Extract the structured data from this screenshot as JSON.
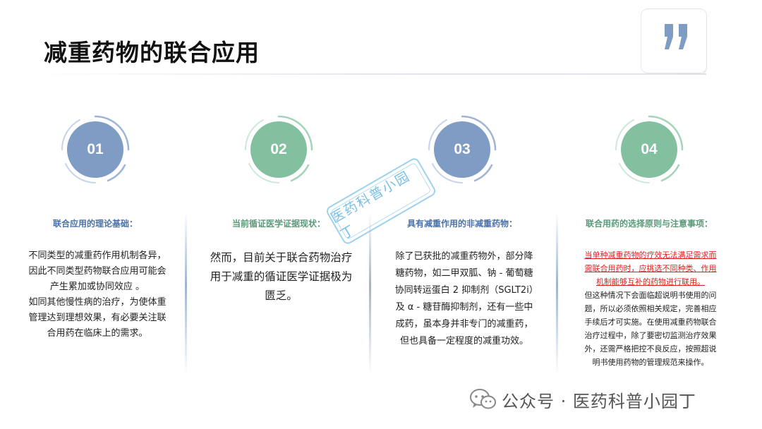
{
  "header": {
    "title": "减重药物的联合应用"
  },
  "colors": {
    "blue_badge": "#7f9cc4",
    "green_badge": "#82c09f",
    "blue_heading": "#4a72a8",
    "green_heading": "#5a9a7a",
    "highlight_red": "#e02020"
  },
  "columns": [
    {
      "number": "01",
      "heading": "联合应用的理论基础：",
      "paragraphs": [
        "不同类型的减重药作用机制各异，因此不同类型药物联合应用可能会产生累加或协同效应 。",
        "如同其他慢性病的治疗，为使体重管理达到理想效果，有必要关注联合用药在临床上的需求。"
      ]
    },
    {
      "number": "02",
      "heading": "当前循证医学证据现状：",
      "paragraphs": [
        "然而，目前关于联合药物治疗用于减重的循证医学证据极为匮乏。"
      ]
    },
    {
      "number": "03",
      "heading": "具有减重作用的非减重药物：",
      "paragraphs": [
        "除了已获批的减重药物外，部分降糖药物，如二甲双胍、钠 - 葡萄糖协同转运蛋白 2 抑制剂（SGLT2i）及 α - 糖苷酶抑制剂，还有一些中成药，虽本身并非专门的减重药，但也具备一定程度的减重功效。"
      ]
    },
    {
      "number": "04",
      "heading": "联合用药的选择原则与注意事项：",
      "highlight": "当单种减重药物的疗效无法满足需求而需联合用药时，应挑选不同种类、作用机制能够互补的药物进行联用。",
      "paragraphs": [
        "但这种情况下会面临超说明书使用的问题，所以必须依照相关规定，完善相应手续后才可实施。在使用减重药物联合治疗过程中，除了要密切监测治疗效果外，还需严格把控不良反应，按照超说明书使用药物的管理规范来操作。"
      ]
    }
  ],
  "watermark": {
    "stamp_text": "医药科普小园丁"
  },
  "footer": {
    "account": "公众号 · 医药科普小园丁"
  },
  "icons": {
    "quote": "quote-icon",
    "wechat": "wechat-icon"
  }
}
